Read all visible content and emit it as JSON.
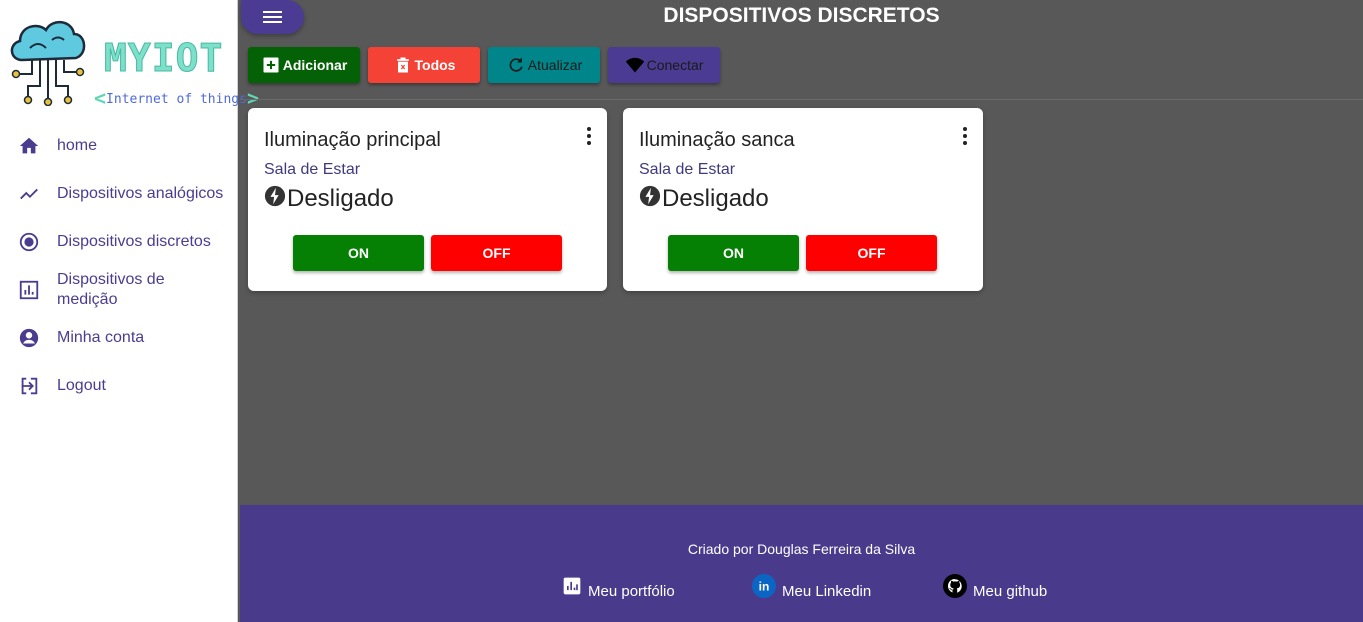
{
  "sidebar": {
    "logo": {
      "title": "MYIOT",
      "subtitle": "Internet of things"
    },
    "items": [
      {
        "label": "home",
        "icon": "home-icon"
      },
      {
        "label": "Dispositivos analógicos",
        "icon": "trending-line-icon"
      },
      {
        "label": "Dispositivos discretos",
        "icon": "radio-button-icon"
      },
      {
        "label": "Dispositivos de medição",
        "icon": "bar-chart-icon"
      },
      {
        "label": "Minha conta",
        "icon": "account-circle-icon"
      },
      {
        "label": "Logout",
        "icon": "logout-icon"
      }
    ]
  },
  "header": {
    "title": "DISPOSITIVOS DISCRETOS"
  },
  "toolbar": {
    "add_label": "Adicionar",
    "all_label": "Todos",
    "refresh_label": "Atualizar",
    "connect_label": "Conectar"
  },
  "cards": [
    {
      "title": "Iluminação principal",
      "room": "Sala de Estar",
      "status": "Desligado",
      "on_label": "ON",
      "off_label": "OFF"
    },
    {
      "title": "Iluminação sanca",
      "room": "Sala de Estar",
      "status": "Desligado",
      "on_label": "ON",
      "off_label": "OFF"
    }
  ],
  "footer": {
    "credit": "Criado por Douglas Ferreira da Silva",
    "links": [
      {
        "label": "Meu portfólio",
        "icon": "chart-box-icon"
      },
      {
        "label": "Meu Linkedin",
        "icon": "linkedin-icon"
      },
      {
        "label": "Meu github",
        "icon": "github-icon"
      }
    ]
  },
  "colors": {
    "primary": "#4a3a8c",
    "add": "#056105",
    "delete": "#f44336",
    "refresh": "#00868a",
    "connect": "#4b3b93",
    "on": "#058005",
    "off": "#ff0000"
  }
}
